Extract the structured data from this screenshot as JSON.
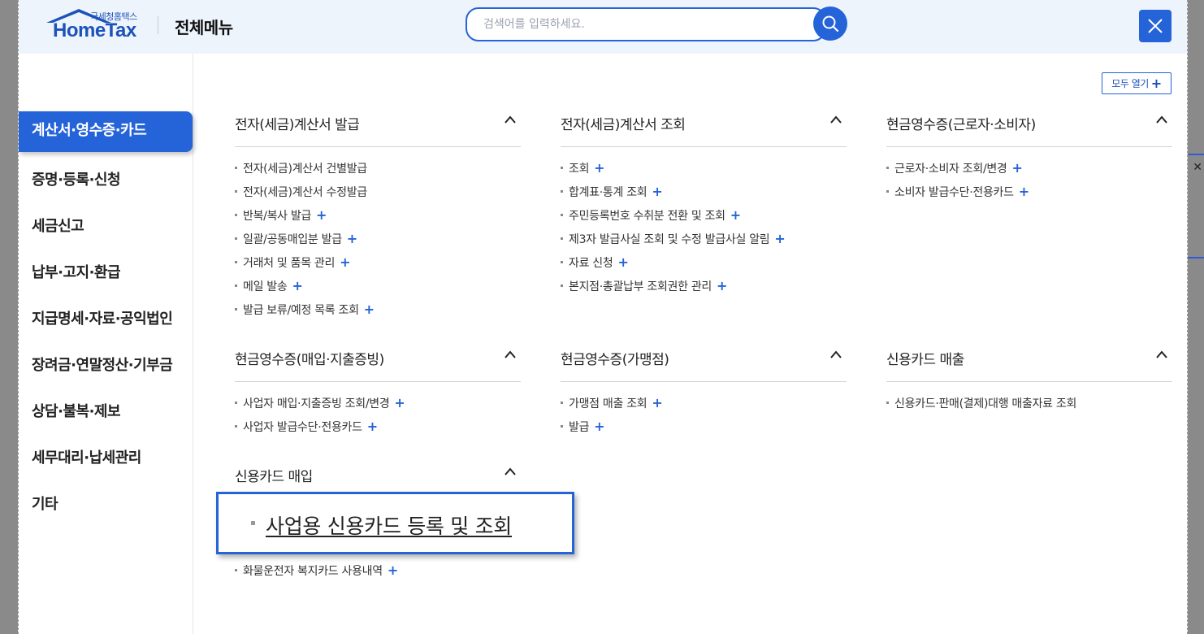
{
  "header": {
    "logo_small": "국세청홈택스",
    "logo_main": "HomeTax",
    "menu_title": "전체메뉴",
    "search_placeholder": "검색어를 입력하세요.",
    "search_icon": "search-icon",
    "close_icon": "close-icon"
  },
  "open_all": {
    "label": "모두 열기",
    "icon": "plus-icon"
  },
  "sidebar": {
    "active": "계산서·영수증·카드",
    "items": [
      "증명·등록·신청",
      "세금신고",
      "납부·고지·환급",
      "지급명세·자료·공익법인",
      "장려금·연말정산·기부금",
      "상담·불복·제보",
      "세무대리·납세관리",
      "기타"
    ]
  },
  "sections": [
    {
      "title": "전자(세금)계산서 발급",
      "items": [
        {
          "label": "전자(세금)계산서 건별발급",
          "plus": ""
        },
        {
          "label": "전자(세금)계산서 수정발급",
          "plus": ""
        },
        {
          "label": "반복/복사 발급",
          "plus": "+"
        },
        {
          "label": "일괄/공동매입분 발급",
          "plus": "+"
        },
        {
          "label": "거래처 및 품목 관리",
          "plus": "+"
        },
        {
          "label": "메일 발송",
          "plus": "+"
        },
        {
          "label": "발급 보류/예정 목록 조회",
          "plus": "+"
        }
      ]
    },
    {
      "title": "전자(세금)계산서 조회",
      "items": [
        {
          "label": "조회",
          "plus": "+"
        },
        {
          "label": "합계표·통계 조회",
          "plus": "+"
        },
        {
          "label": "주민등록번호 수취분 전환 및 조회",
          "plus": "+"
        },
        {
          "label": "제3자 발급사실 조회 및 수정 발급사실 알림",
          "plus": "+"
        },
        {
          "label": "자료 신청",
          "plus": "+"
        },
        {
          "label": "본지점·총괄납부 조회권한 관리",
          "plus": "+"
        }
      ]
    },
    {
      "title": "현금영수증(근로자·소비자)",
      "items": [
        {
          "label": "근로자·소비자 조회/변경",
          "plus": "+"
        },
        {
          "label": "소비자 발급수단·전용카드",
          "plus": "+"
        }
      ]
    },
    {
      "title": "현금영수증(매입·지출증빙)",
      "items": [
        {
          "label": "사업자 매입·지출증빙 조회/변경",
          "plus": "+"
        },
        {
          "label": "사업자 발급수단·전용카드",
          "plus": "+"
        }
      ]
    },
    {
      "title": "현금영수증(가맹점)",
      "items": [
        {
          "label": "가맹점 매출 조회",
          "plus": "+"
        },
        {
          "label": "발급",
          "plus": "+"
        }
      ]
    },
    {
      "title": "신용카드 매출",
      "items": [
        {
          "label": "신용카드·판매(결제)대행 매출자료 조회",
          "plus": ""
        }
      ]
    },
    {
      "title": "신용카드 매입",
      "items": [
        {
          "label": "화물운전자 복지카드 사용내역",
          "plus": "+"
        }
      ]
    }
  ],
  "highlight": {
    "label": "사업용 신용카드 등록 및 조회"
  },
  "colors": {
    "accent": "#2563d8",
    "header_bg": "#edf4fc"
  }
}
